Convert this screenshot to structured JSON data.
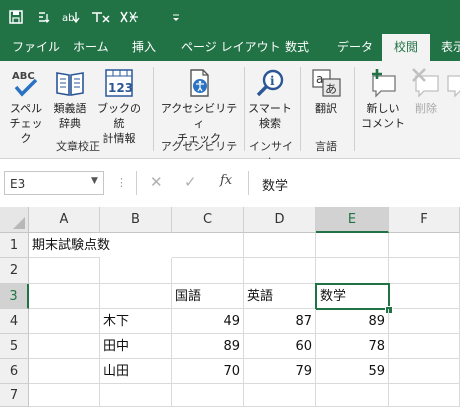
{
  "qat": {
    "icons": [
      "save-icon",
      "touch-mode-icon",
      "format-icon",
      "clear-icon",
      "strikethrough-icon",
      "customize-icon"
    ]
  },
  "ribbon_tabs": [
    "ファイル",
    "ホーム",
    "挿入",
    "ページ レイアウト",
    "数式",
    "データ",
    "校閲",
    "表示"
  ],
  "active_tab": "校閲",
  "ribbon": {
    "spelling": [
      "スペル",
      "チェック"
    ],
    "thesaurus": [
      "類義語",
      "辞典"
    ],
    "workbook_stats": [
      "ブックの統",
      "計情報"
    ],
    "group_proofing": "文章校正",
    "accessibility_check": [
      "アクセシビリティ",
      "チェック"
    ],
    "group_accessibility": "アクセシビリティ",
    "smart_lookup": [
      "スマート",
      "検索"
    ],
    "group_insights": "インサイト",
    "translate": "翻訳",
    "group_language": "言語",
    "new_comment": [
      "新しい",
      "コメント"
    ],
    "delete_comment": "削除"
  },
  "formula_bar": {
    "name_box": "E3",
    "fx": "fx",
    "content": "数学"
  },
  "sheet": {
    "columns": [
      "A",
      "B",
      "C",
      "D",
      "E",
      "F"
    ],
    "rows": [
      "1",
      "2",
      "3",
      "4",
      "5",
      "6",
      "7"
    ],
    "selected_column": "E",
    "selected_row": "3",
    "title": "期末試験点数",
    "headers": [
      "国語",
      "英語",
      "数学"
    ],
    "students": [
      {
        "name": "木下",
        "scores": [
          "49",
          "87",
          "89"
        ]
      },
      {
        "name": "田中",
        "scores": [
          "89",
          "60",
          "78"
        ]
      },
      {
        "name": "山田",
        "scores": [
          "70",
          "79",
          "59"
        ]
      }
    ]
  },
  "colors": {
    "excel_green": "#217346",
    "ribbon_bg": "#f3f3f3",
    "header_bg": "#f0f0f0"
  }
}
